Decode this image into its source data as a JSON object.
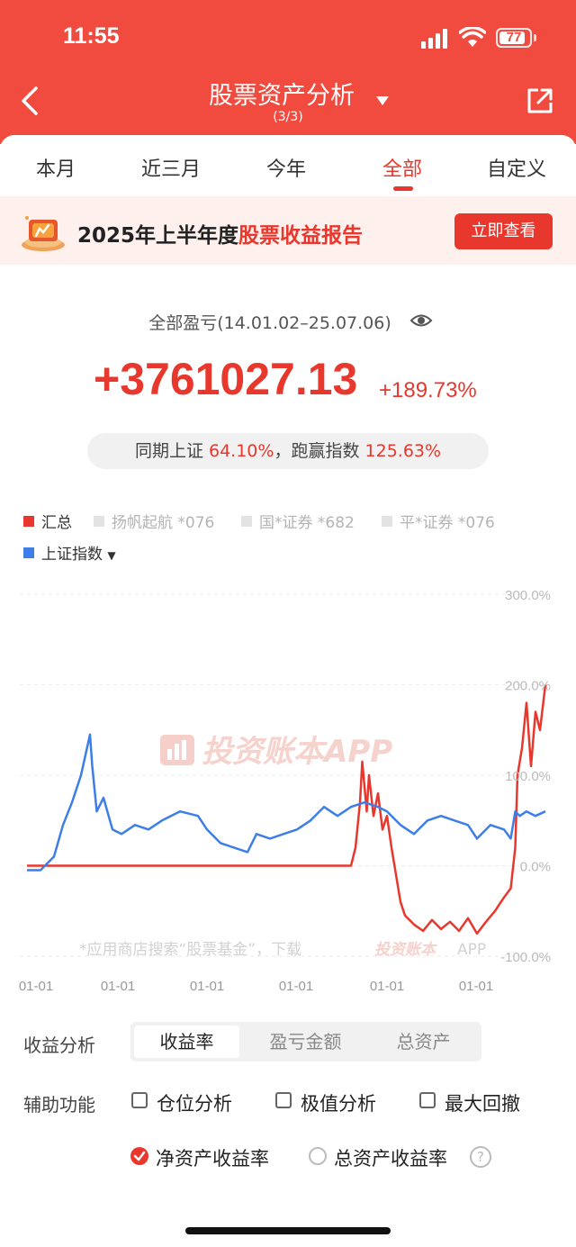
{
  "status": {
    "time": "11:55",
    "battery": "77"
  },
  "header": {
    "title": "股票资产分析",
    "subtitle": "(3/3)"
  },
  "tabs": [
    "本月",
    "近三月",
    "今年",
    "全部",
    "自定义"
  ],
  "active_tab": "全部",
  "banner": {
    "text_main": "2025年上半年度",
    "text_highlight": "股票收益报告",
    "button": "立即查看"
  },
  "summary": {
    "label": "全部盈亏(14.01.02–25.07.06)",
    "value": "+3761027.13",
    "percent": "+189.73%",
    "compare_prefix": "同期上证",
    "compare_index": "64.10%",
    "compare_mid": "，跑赢指数",
    "compare_beat": "125.63%"
  },
  "legend": [
    {
      "label": "汇总",
      "color": "#e8372d",
      "active": true
    },
    {
      "label": "扬帆起航 *076",
      "color": "#e3e3e3",
      "active": false
    },
    {
      "label": "国*证券 *682",
      "color": "#e3e3e3",
      "active": false
    },
    {
      "label": "平*证券 *076",
      "color": "#e3e3e3",
      "active": false
    },
    {
      "label": "上证指数",
      "color": "#3d7ee8",
      "active": true
    }
  ],
  "watermark": {
    "logo": "投资账本APP",
    "hint": "*应用商店搜索“股票基金”，下载",
    "hint_logo": "投资账本",
    "hint_tail": "APP"
  },
  "chart_data": {
    "type": "line",
    "y_ticks": [
      "300.0%",
      "200.0%",
      "100.0%",
      "0.0%",
      "-100.0%"
    ],
    "ylim": [
      -100,
      300
    ],
    "x_ticks": [
      "01-01",
      "01-01",
      "01-01",
      "01-01",
      "01-01",
      "01-01"
    ],
    "x_range": [
      2014.0,
      2025.52
    ],
    "series": [
      {
        "name": "汇总",
        "color": "#e8372d",
        "x": [
          2014.0,
          2021.2,
          2021.3,
          2021.4,
          2021.45,
          2021.55,
          2021.6,
          2021.7,
          2021.8,
          2021.9,
          2022.0,
          2022.1,
          2022.2,
          2022.3,
          2022.4,
          2022.5,
          2022.6,
          2022.8,
          2023.0,
          2023.2,
          2023.4,
          2023.6,
          2023.8,
          2024.0,
          2024.2,
          2024.4,
          2024.6,
          2024.75,
          2024.85,
          2024.9,
          2025.0,
          2025.1,
          2025.2,
          2025.3,
          2025.4,
          2025.52
        ],
        "values": [
          0,
          0,
          20,
          70,
          115,
          60,
          100,
          55,
          80,
          40,
          55,
          20,
          -10,
          -40,
          -55,
          -60,
          -65,
          -72,
          -60,
          -70,
          -62,
          -72,
          -58,
          -75,
          -62,
          -50,
          -35,
          -25,
          20,
          100,
          130,
          180,
          110,
          170,
          150,
          200
        ]
      },
      {
        "name": "上证指数",
        "color": "#3d7ee8",
        "x": [
          2014.0,
          2014.3,
          2014.6,
          2014.8,
          2015.0,
          2015.2,
          2015.4,
          2015.45,
          2015.55,
          2015.7,
          2015.9,
          2016.1,
          2016.4,
          2016.7,
          2017.0,
          2017.4,
          2017.8,
          2018.0,
          2018.3,
          2018.6,
          2018.9,
          2019.1,
          2019.4,
          2019.7,
          2020.0,
          2020.3,
          2020.6,
          2020.9,
          2021.2,
          2021.5,
          2021.8,
          2022.0,
          2022.3,
          2022.6,
          2022.9,
          2023.2,
          2023.5,
          2023.8,
          2024.0,
          2024.3,
          2024.6,
          2024.75,
          2024.85,
          2024.95,
          2025.1,
          2025.3,
          2025.52
        ],
        "values": [
          -5,
          -5,
          10,
          45,
          70,
          100,
          145,
          110,
          60,
          75,
          40,
          35,
          45,
          40,
          50,
          60,
          55,
          40,
          25,
          20,
          15,
          35,
          30,
          35,
          40,
          50,
          65,
          55,
          65,
          70,
          65,
          60,
          45,
          35,
          50,
          55,
          50,
          45,
          30,
          45,
          40,
          30,
          60,
          55,
          60,
          55,
          60
        ]
      }
    ]
  },
  "analysis": {
    "label": "收益分析",
    "options": [
      "收益率",
      "盈亏金额",
      "总资产"
    ],
    "active": "收益率"
  },
  "aux": {
    "label": "辅助功能",
    "options": [
      "仓位分析",
      "极值分析",
      "最大回撤"
    ]
  },
  "rate_type": {
    "options": [
      "净资产收益率",
      "总资产收益率"
    ],
    "selected": "净资产收益率"
  }
}
